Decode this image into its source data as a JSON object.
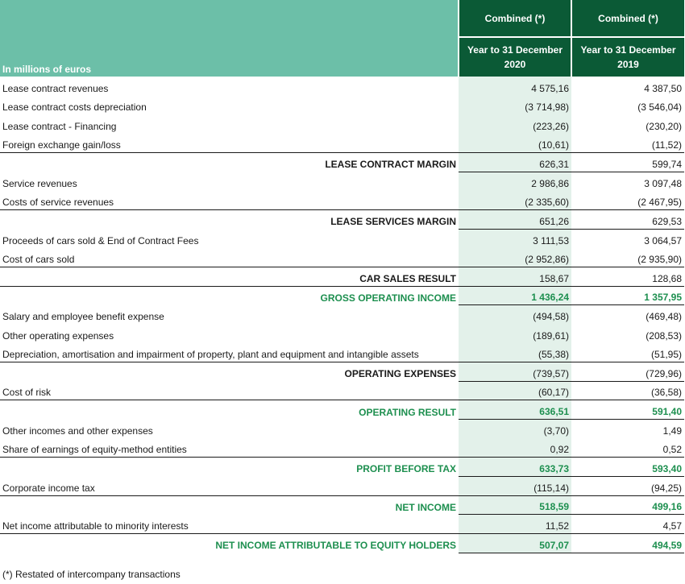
{
  "header": {
    "units_label": "In millions of euros",
    "col1_top": "Combined (*)",
    "col2_top": "Combined (*)",
    "col1_period_line1": "Year to 31 December",
    "col1_period_line2": "2020",
    "col2_period_line1": "Year to 31 December",
    "col2_period_line2": "2019"
  },
  "rows": [
    {
      "label": "Lease contract revenues",
      "v2020": "4 575,16",
      "v2019": "4 387,50"
    },
    {
      "label": "Lease contract costs depreciation",
      "v2020": "(3 714,98)",
      "v2019": "(3 546,04)"
    },
    {
      "label": "Lease contract - Financing",
      "v2020": "(223,26)",
      "v2019": "(230,20)"
    },
    {
      "label": "Foreign exchange gain/loss",
      "v2020": "(10,61)",
      "v2019": "(11,52)"
    },
    {
      "label": "LEASE CONTRACT MARGIN",
      "v2020": "626,31",
      "v2019": "599,74"
    },
    {
      "label": "Service revenues",
      "v2020": "2 986,86",
      "v2019": "3 097,48"
    },
    {
      "label": "Costs of service revenues",
      "v2020": "(2 335,60)",
      "v2019": "(2 467,95)"
    },
    {
      "label": "LEASE SERVICES MARGIN",
      "v2020": "651,26",
      "v2019": "629,53"
    },
    {
      "label": "Proceeds of cars sold & End of Contract Fees",
      "v2020": "3 111,53",
      "v2019": "3 064,57"
    },
    {
      "label": "Cost of cars sold",
      "v2020": "(2 952,86)",
      "v2019": "(2 935,90)"
    },
    {
      "label": "CAR SALES RESULT",
      "v2020": "158,67",
      "v2019": "128,68"
    },
    {
      "label": "GROSS OPERATING INCOME",
      "v2020": "1 436,24",
      "v2019": "1 357,95"
    },
    {
      "label": "Salary and employee benefit expense",
      "v2020": "(494,58)",
      "v2019": "(469,48)"
    },
    {
      "label": "Other operating expenses",
      "v2020": "(189,61)",
      "v2019": "(208,53)"
    },
    {
      "label": "Depreciation, amortisation and impairment of property, plant and equipment and intangible assets",
      "v2020": "(55,38)",
      "v2019": "(51,95)"
    },
    {
      "label": "OPERATING EXPENSES",
      "v2020": "(739,57)",
      "v2019": "(729,96)"
    },
    {
      "label": "Cost of risk",
      "v2020": "(60,17)",
      "v2019": "(36,58)"
    },
    {
      "label": "OPERATING RESULT",
      "v2020": "636,51",
      "v2019": "591,40"
    },
    {
      "label": "Other incomes and other expenses",
      "v2020": "(3,70)",
      "v2019": "1,49"
    },
    {
      "label": "Share of earnings of equity-method entities",
      "v2020": "0,92",
      "v2019": "0,52"
    },
    {
      "label": "PROFIT BEFORE TAX",
      "v2020": "633,73",
      "v2019": "593,40"
    },
    {
      "label": "Corporate income tax",
      "v2020": "(115,14)",
      "v2019": "(94,25)"
    },
    {
      "label": "NET INCOME",
      "v2020": "518,59",
      "v2019": "499,16"
    },
    {
      "label": "Net income attributable to minority interests",
      "v2020": "11,52",
      "v2019": "4,57"
    },
    {
      "label": "NET INCOME ATTRIBUTABLE TO EQUITY HOLDERS",
      "v2020": "507,07",
      "v2019": "494,59"
    }
  ],
  "footnote": "(*) Restated of intercompany transactions",
  "colors": {
    "header_light": "#6cbfa8",
    "header_dark": "#0b5a36",
    "column_shade": "#e3f1ea",
    "green_text": "#1d8f4f"
  }
}
